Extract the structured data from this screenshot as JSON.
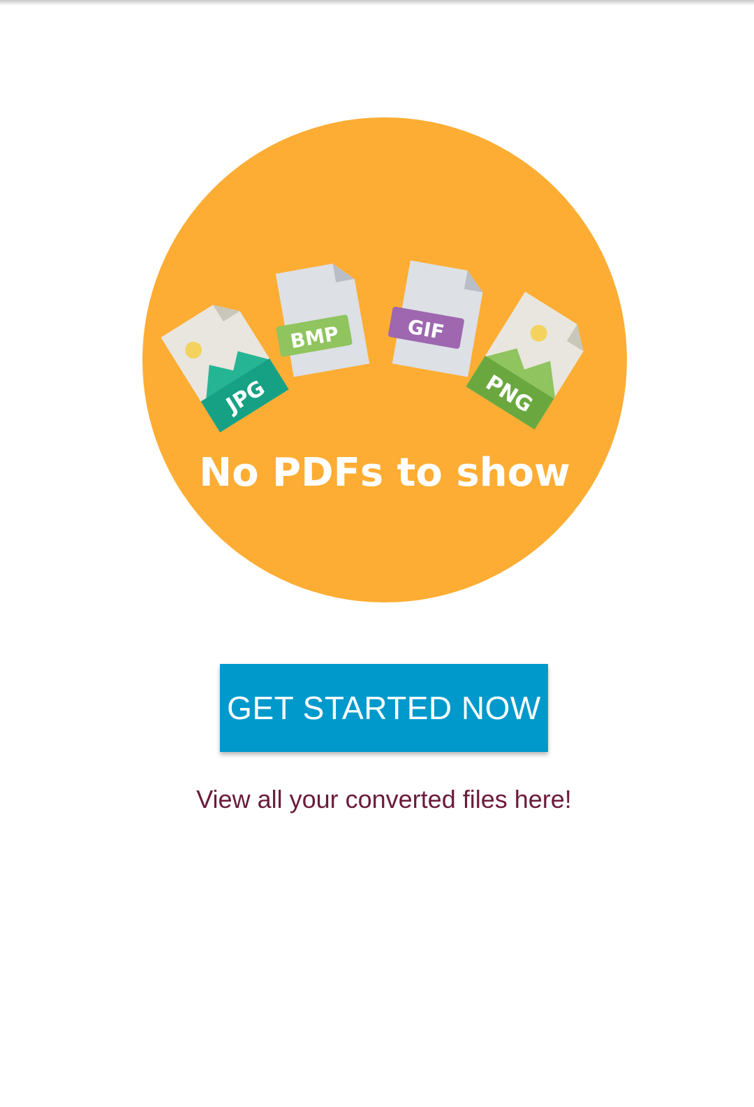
{
  "empty_state": {
    "title": "No PDFs to show",
    "file_types": [
      "JPG",
      "BMP",
      "GIF",
      "PNG"
    ]
  },
  "cta": {
    "label": "GET STARTED NOW"
  },
  "subtitle": "View all your converted files here!",
  "colors": {
    "circle": "#fdad33",
    "button": "#0099cc",
    "subtitle_text": "#6a1b3a",
    "jpg_tag": "#26b594",
    "bmp_tag": "#8fc45e",
    "gif_tag": "#9e67b0",
    "png_tag": "#6aa83f"
  },
  "icons": [
    "jpg-file-icon",
    "bmp-file-icon",
    "gif-file-icon",
    "png-file-icon"
  ]
}
